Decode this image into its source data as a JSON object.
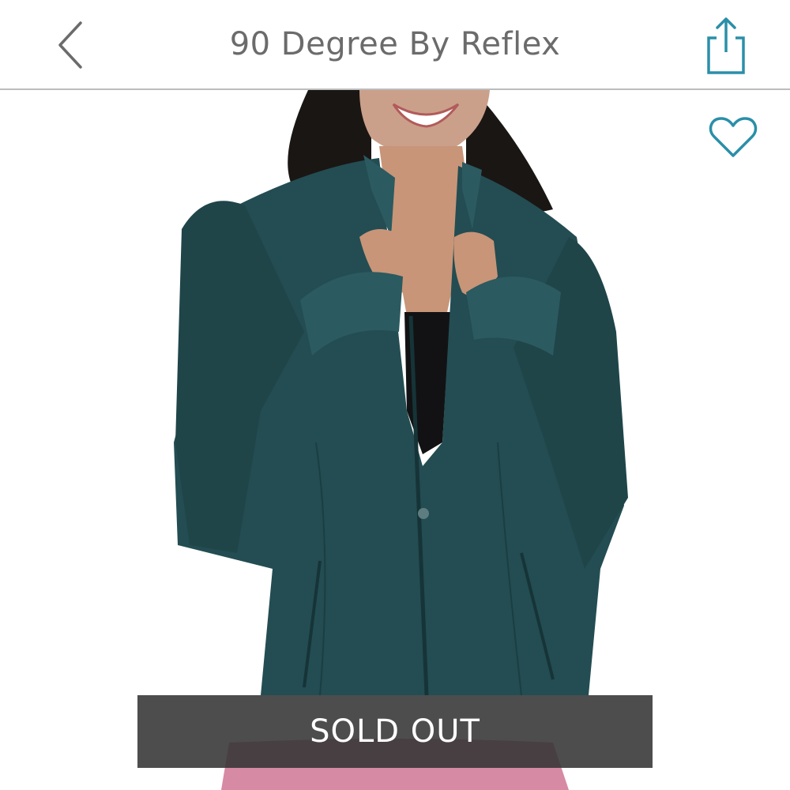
{
  "header": {
    "title": "90 Degree By Reflex",
    "back_icon": "chevron-left-icon",
    "share_icon": "share-icon"
  },
  "product": {
    "favorite_icon": "heart-outline-icon",
    "status_banner": "SOLD OUT"
  },
  "colors": {
    "accent": "#2a8fa8",
    "header_text": "#6b6b6b",
    "banner_bg": "#343434",
    "jacket": "#234d52"
  }
}
